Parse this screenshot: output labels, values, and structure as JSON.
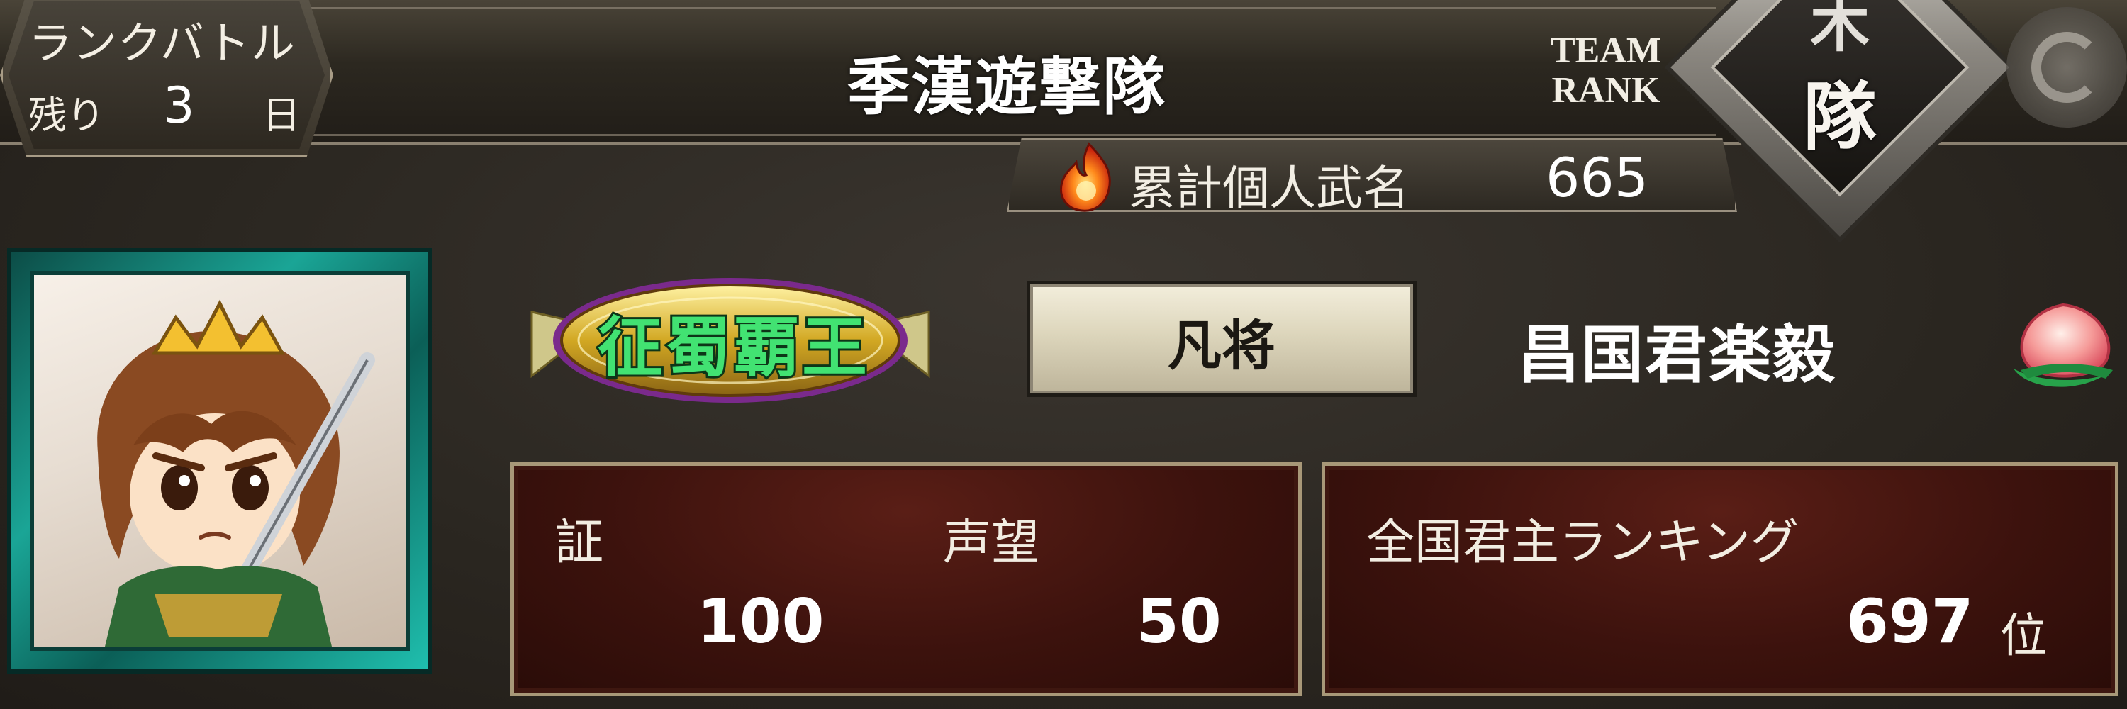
{
  "header": {
    "rank_battle": {
      "label": "ランクバトル",
      "days_left_label": "残り",
      "days_left_value": "3",
      "days_left_unit": "日"
    },
    "team_name": "季漢遊撃隊",
    "team_rank": {
      "label_line1": "TEAM",
      "label_line2": "RANK",
      "glyph": "隊",
      "emblem_icon": "team-rank-diamond-emblem"
    },
    "decoration_icon": "spiral-icon"
  },
  "cumulative": {
    "icon": "flame-icon",
    "label": "累計個人武名",
    "value": "665"
  },
  "profile": {
    "avatar_icon": "general-portrait-avatar",
    "title_badge": "征蜀覇王",
    "rank": "凡将",
    "lord_name": "昌国君楽毅",
    "peach_icon": "peach-icon"
  },
  "stats": {
    "proof_label": "証",
    "proof_value": "100",
    "reputation_label": "声望",
    "reputation_value": "50"
  },
  "ranking": {
    "label": "全国君主ランキング",
    "value": "697",
    "unit": "位"
  },
  "colors": {
    "accent_green": "#42e272",
    "panel_red": "#3c120d",
    "frame_teal": "#1aa596"
  }
}
